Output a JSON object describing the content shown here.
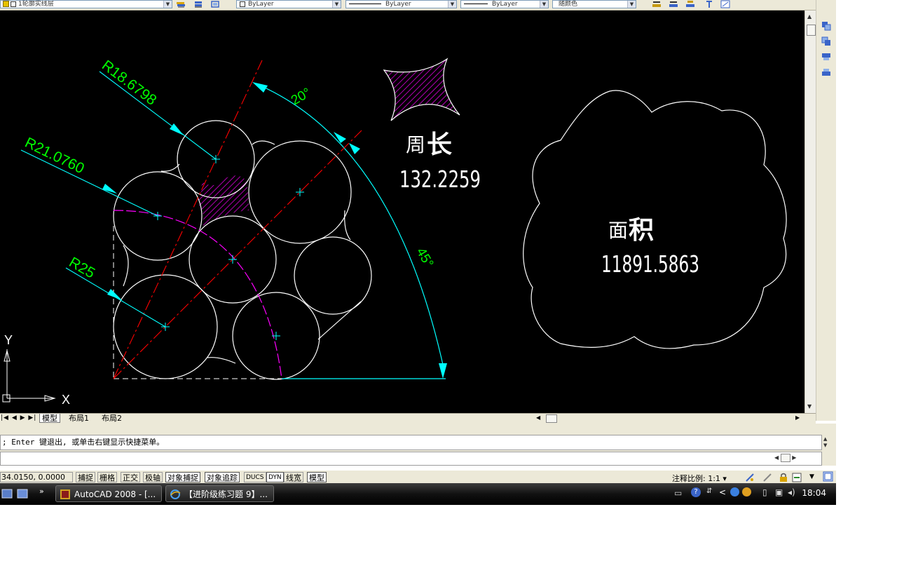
{
  "toolbar": {
    "layer_combo": "1轮廓实线层",
    "color_combo": "ByLayer",
    "linetype_combo": "ByLayer",
    "lineweight_combo": "ByLayer",
    "plotstyle_combo": "随颜色"
  },
  "drawing": {
    "dim_r186798": "R18.6798",
    "dim_r210760": "R21.0760",
    "dim_r25": "R25",
    "angle_20": "20°",
    "angle_45": "45°",
    "perimeter_label_a": "周",
    "perimeter_label_b": "长",
    "perimeter_value": "132.2259",
    "area_label_a": "面",
    "area_label_b": "积",
    "area_value": "11891.5863",
    "ucs_y": "Y",
    "ucs_x": "X"
  },
  "tabs": {
    "model": "模型",
    "layout1": "布局1",
    "layout2": "布局2"
  },
  "command": {
    "line1": "; Enter 键退出, 或单击右键显示快捷菜单。"
  },
  "status": {
    "coords": "34.0150, 0.0000",
    "buttons": [
      "捕捉",
      "栅格",
      "正交",
      "极轴",
      "对象捕捉",
      "对象追踪",
      "DUCS",
      "DYN",
      "线宽",
      "模型"
    ],
    "annotation_scale_label": "注释比例: ",
    "annotation_scale_value": "1:1"
  },
  "taskbar": {
    "autocad": "AutoCAD 2008 - [...",
    "browser": "【进阶级练习题 9】...",
    "clock": "18:04"
  },
  "colors": {
    "canvas": "#000000",
    "geometry": "#ffffff",
    "centerline": "#ff0000",
    "dimension": "#00ffff",
    "dim_text": "#00ff00",
    "arc": "#ff00ff",
    "hatch": "#ff00ff",
    "crosshair": "#00ffff"
  }
}
